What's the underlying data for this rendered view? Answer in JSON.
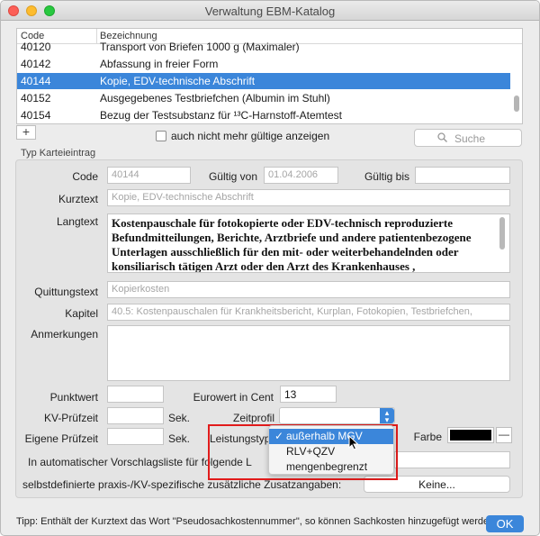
{
  "window": {
    "title": "Verwaltung EBM-Katalog"
  },
  "table": {
    "columns": [
      "Code",
      "Bezeichnung"
    ],
    "rows": [
      {
        "code": "40120",
        "bezeichnung": "Transport von Briefen 1000 g (Maximaler)"
      },
      {
        "code": "40142",
        "bezeichnung": "Abfassung in freier Form"
      },
      {
        "code": "40144",
        "bezeichnung": "Kopie, EDV-technische Abschrift"
      },
      {
        "code": "40152",
        "bezeichnung": "Ausgegebenes Testbriefchen (Albumin im Stuhl)"
      },
      {
        "code": "40154",
        "bezeichnung": "Bezug der Testsubstanz für ¹³C-Harnstoff-Atemtest"
      }
    ]
  },
  "toolbar": {
    "add_label": "+",
    "checkbox_label": "auch nicht mehr gültige anzeigen",
    "search_label": "Suche",
    "search_icon": "magnifier-icon"
  },
  "group": {
    "label": "Typ Karteieintrag"
  },
  "form": {
    "code_label": "Code",
    "code_value": "40144",
    "gueltig_von_label": "Gültig von",
    "gueltig_von_value": "01.04.2006",
    "gueltig_bis_label": "Gültig bis",
    "gueltig_bis_value": "",
    "kurztext_label": "Kurztext",
    "kurztext_value": "Kopie, EDV-technische Abschrift",
    "langtext_label": "Langtext",
    "langtext_value": "Kostenpauschale für fotokopierte oder EDV-technisch reproduzierte Befundmitteilungen, Berichte, Arztbriefe und andere patientenbezogene Unterlagen ausschließlich für den mit- oder weiterbehandelnden oder konsiliarisch tätigen Arzt oder den Arzt des Krankenhauses ,",
    "quittungstext_label": "Quittungstext",
    "quittungstext_value": "Kopierkosten",
    "kapitel_label": "Kapitel",
    "kapitel_value": "40.5: Kostenpauschalen für Krankheitsbericht, Kurplan, Fotokopien, Testbriefchen,",
    "anmerkungen_label": "Anmerkungen",
    "punktwert_label": "Punktwert",
    "eurowert_label": "Eurowert in Cent",
    "eurowert_value": "13",
    "kv_pruefzeit_label": "KV-Prüfzeit",
    "sek_label_1": "Sek.",
    "zeitprofil_label": "Zeitprofil",
    "eigene_pruefzeit_label": "Eigene Prüfzeit",
    "sek_label_2": "Sek.",
    "leistungstyp_label": "Leistungstyp",
    "farbe_label": "Farbe",
    "farbe_value": "#000000",
    "vorschlagsliste_label": "In automatischer Vorschlagsliste für folgende L",
    "zusatz_label": "selbstdefinierte praxis-/KV-spezifische zusätzliche Zusatzangaben:",
    "keine_button": "Keine..."
  },
  "dropdown": {
    "checkmark": "✓",
    "options": [
      "außerhalb MGV",
      "RLV+QZV",
      "mengenbegrenzt"
    ],
    "selected": "außerhalb MGV"
  },
  "footer": {
    "tipp": "Tipp: Enthält der Kurztext das Wort \"Pseudosachkostennummer\", so können Sachkosten hinzugefügt werden.",
    "ok_button": "OK"
  },
  "colors": {
    "accent": "#3b86da",
    "highlight_box": "#e11b1b"
  }
}
